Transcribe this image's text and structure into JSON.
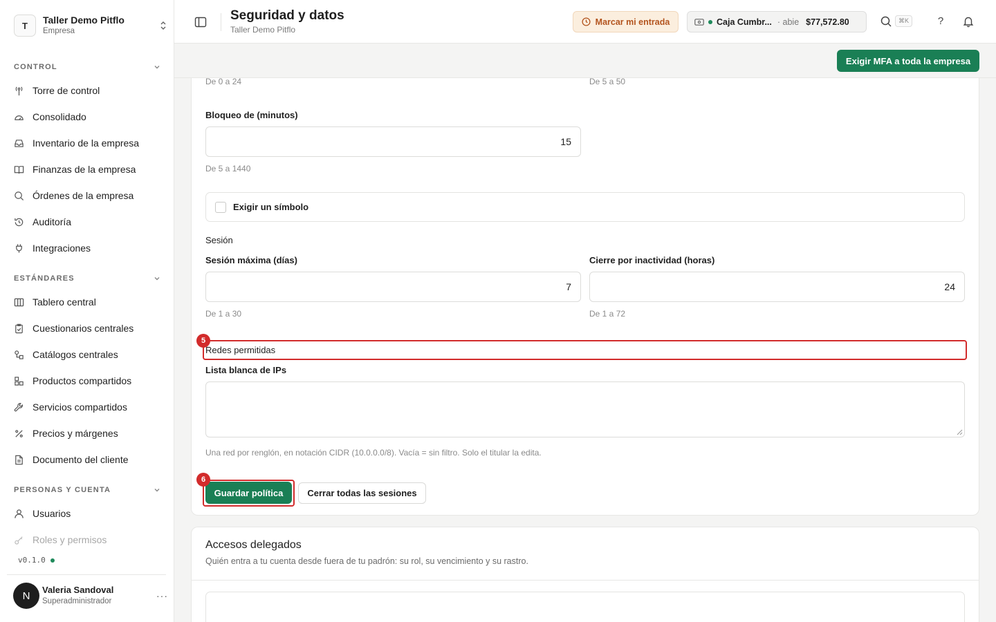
{
  "org": {
    "initial": "T",
    "name": "Taller Demo Pitflo",
    "type": "Empresa"
  },
  "sidebar": {
    "sections": [
      {
        "label": "CONTROL",
        "items": [
          "Torre de control",
          "Consolidado",
          "Inventario de la empresa",
          "Finanzas de la empresa",
          "Órdenes de la empresa",
          "Auditoría",
          "Integraciones"
        ]
      },
      {
        "label": "ESTÁNDARES",
        "items": [
          "Tablero central",
          "Cuestionarios centrales",
          "Catálogos centrales",
          "Productos compartidos",
          "Servicios compartidos",
          "Precios y márgenes",
          "Documento del cliente"
        ]
      },
      {
        "label": "PERSONAS Y CUENTA",
        "items": [
          "Usuarios",
          "Roles y permisos"
        ]
      }
    ],
    "version": "v0.1.0"
  },
  "user": {
    "initial": "N",
    "name": "Valeria Sandoval",
    "role": "Superadministrador",
    "more": "···"
  },
  "header": {
    "title": "Seguridad y datos",
    "subtitle": "Taller Demo Pitflo",
    "clock_in": "Marcar mi entrada",
    "cash": {
      "name": "Caja Cumbr...",
      "status": "· abie",
      "amount": "$77,572.80"
    },
    "shortcut": "⌘K",
    "help": "?"
  },
  "actions": {
    "mfa": "Exigir MFA a toda la empresa"
  },
  "policy": {
    "hint_top_left": "De 0 a 24",
    "hint_top_right": "De 5 a 50",
    "lockout_label": "Bloqueo de (minutos)",
    "lockout_value": "15",
    "lockout_hint": "De 5 a 1440",
    "symbol_label": "Exigir un símbolo",
    "symbol_checked": false,
    "session_heading": "Sesión",
    "session_max_label": "Sesión máxima (días)",
    "session_max_value": "7",
    "session_max_hint": "De 1 a 30",
    "idle_label": "Cierre por inactividad (horas)",
    "idle_value": "24",
    "idle_hint": "De 1 a 72",
    "networks_heading": "Redes permitidas",
    "ip_label": "Lista blanca de IPs",
    "ip_value": "",
    "ip_hint": "Una red por renglón, en notación CIDR (10.0.0.0/8). Vacía = sin filtro. Solo el titular la edita.",
    "save": "Guardar política",
    "close_sessions": "Cerrar todas las sesiones"
  },
  "annotations": {
    "badge_networks": "5",
    "badge_save": "6",
    "color": "#d22b2b"
  },
  "delegated": {
    "title": "Accesos delegados",
    "description": "Quién entra a tu cuenta desde fuera de tu padrón: su rol, su vencimiento y su rastro."
  },
  "colors": {
    "brand": "#1a7f55",
    "warning_bg": "#fbeede",
    "warning_text": "#b3541e"
  }
}
